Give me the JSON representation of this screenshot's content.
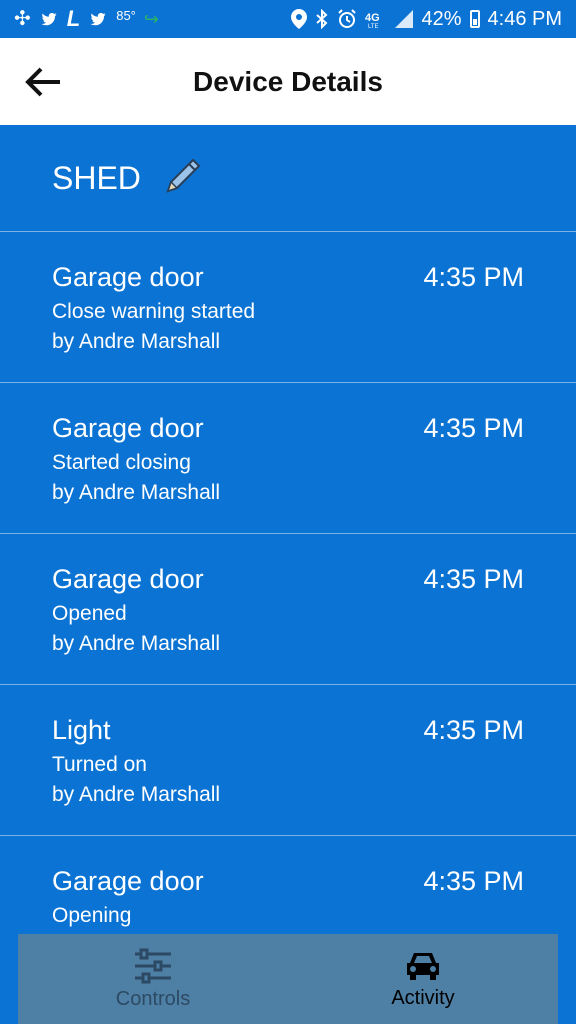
{
  "status_bar": {
    "temperature": "85°",
    "battery": "42%",
    "time": "4:46 PM",
    "icons": [
      "pinwheel-icon",
      "twitter-icon",
      "l-icon",
      "twitter-icon",
      "phone-icon",
      "location-icon",
      "bluetooth-icon",
      "alarm-icon",
      "4g-lte-icon",
      "signal-icon",
      "battery-icon"
    ]
  },
  "header": {
    "title": "Device Details",
    "back_icon": "arrow-left-icon"
  },
  "device": {
    "name": "SHED",
    "edit_icon": "pencil-icon"
  },
  "activity": [
    {
      "event": "Garage door",
      "status": "Close warning started",
      "user": "by Andre Marshall",
      "time": "4:35 PM"
    },
    {
      "event": "Garage door",
      "status": "Started closing",
      "user": "by Andre Marshall",
      "time": "4:35 PM"
    },
    {
      "event": "Garage door",
      "status": "Opened",
      "user": "by Andre Marshall",
      "time": "4:35 PM"
    },
    {
      "event": "Light",
      "status": "Turned on",
      "user": "by Andre Marshall",
      "time": "4:35 PM"
    },
    {
      "event": "Garage door",
      "status": "Opening",
      "user": "",
      "time": "4:35 PM"
    }
  ],
  "bottom_nav": {
    "items": [
      {
        "label": "Controls",
        "icon": "sliders-icon",
        "active": false
      },
      {
        "label": "Activity",
        "icon": "car-icon",
        "active": true
      }
    ],
    "active_color": "#000000",
    "inactive_color": "#2c4a63",
    "background": "#4e7fa5"
  },
  "colors": {
    "primary": "#0b73d3",
    "app_bar": "#ffffff"
  }
}
